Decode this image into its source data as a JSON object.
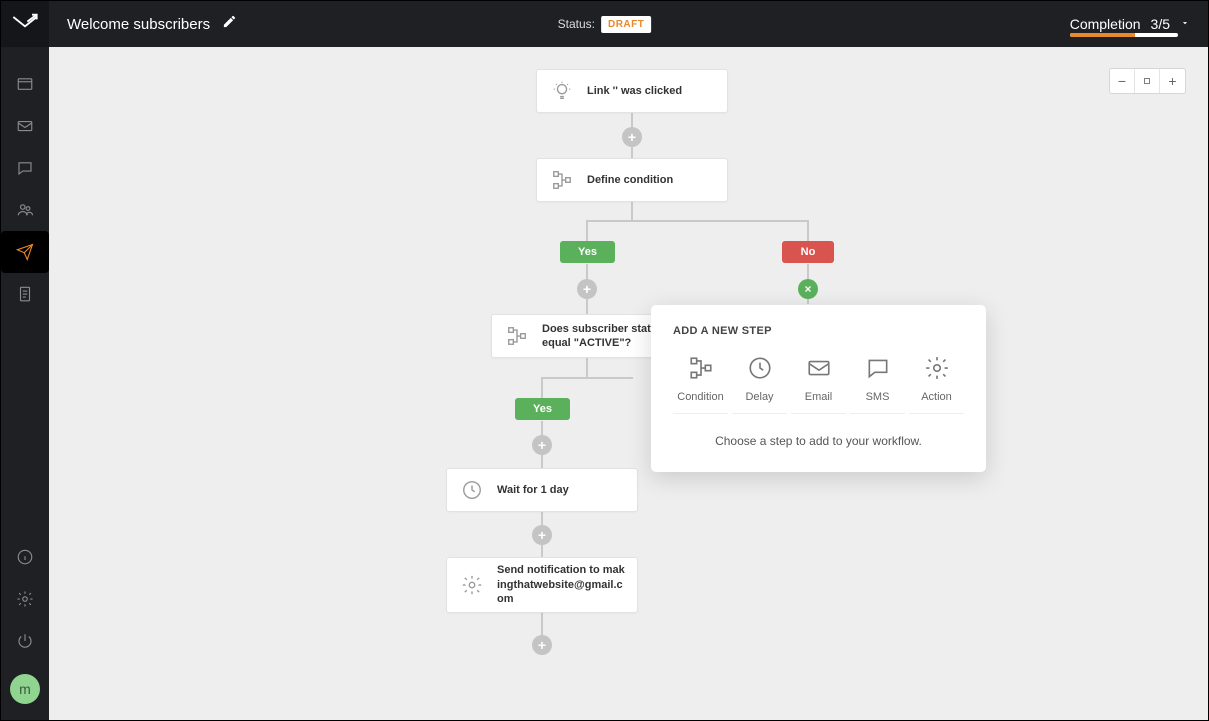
{
  "header": {
    "workflow_name": "Welcome subscribers",
    "status_label": "Status:",
    "status_value": "DRAFT",
    "completion_label": "Completion",
    "completion_count": "3/5",
    "progress_pct": 60
  },
  "sidebar": {
    "top_icons": [
      "dashboard",
      "email",
      "chat",
      "contacts",
      "send",
      "clipboard"
    ],
    "bottom_icons": [
      "info",
      "settings",
      "power"
    ],
    "avatar_letter": "m"
  },
  "zoom": {
    "minus": "−",
    "plus": "+"
  },
  "workflow": {
    "node_trigger": "Link '' was clicked",
    "node_condition1": "Define condition",
    "badge_yes": "Yes",
    "badge_no": "No",
    "node_condition2": "Does subscriber status equal \"ACTIVE\"?",
    "badge_yes2": "Yes",
    "node_delay": "Wait for 1 day",
    "node_action": "Send notification to makingthatwebsite@gmail.com"
  },
  "popover": {
    "title": "ADD A NEW STEP",
    "options": [
      {
        "label": "Condition",
        "icon": "condition"
      },
      {
        "label": "Delay",
        "icon": "clock"
      },
      {
        "label": "Email",
        "icon": "mail"
      },
      {
        "label": "SMS",
        "icon": "sms"
      },
      {
        "label": "Action",
        "icon": "gear"
      }
    ],
    "footer": "Choose a step to add to your workflow."
  }
}
